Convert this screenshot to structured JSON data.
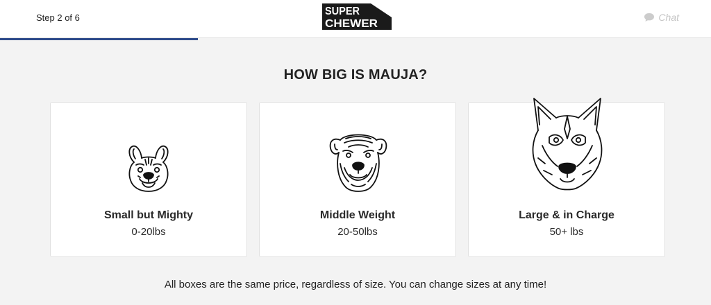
{
  "header": {
    "step_text": "Step 2 of 6",
    "logo_line1": "SUPER",
    "logo_line2": "CHEWER",
    "chat_label": "Chat",
    "chat_icon": "chat-bubble-icon",
    "progress_fraction": 0.278
  },
  "question": "HOW BIG IS MAUJA?",
  "sizes": [
    {
      "title": "Small but Mighty",
      "weight": "0-20lbs",
      "icon": "french-bulldog-icon"
    },
    {
      "title": "Middle Weight",
      "weight": "20-50lbs",
      "icon": "shar-pei-icon"
    },
    {
      "title": "Large & in Charge",
      "weight": "50+ lbs",
      "icon": "husky-icon"
    }
  ],
  "footnote": "All boxes are the same price, regardless of size. You can change sizes at any time!",
  "colors": {
    "progress": "#2d4a8a",
    "background": "#f3f3f3",
    "logo": "#1a1a1a"
  }
}
